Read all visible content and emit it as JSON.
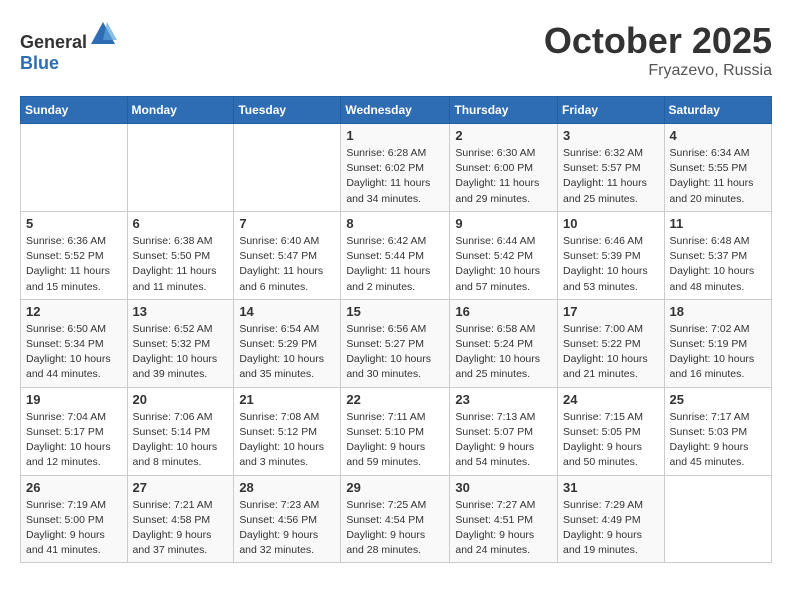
{
  "logo": {
    "text_general": "General",
    "text_blue": "Blue"
  },
  "title": {
    "month_year": "October 2025",
    "location": "Fryazevo, Russia"
  },
  "headers": [
    "Sunday",
    "Monday",
    "Tuesday",
    "Wednesday",
    "Thursday",
    "Friday",
    "Saturday"
  ],
  "weeks": [
    [
      {
        "day": "",
        "sunrise": "",
        "sunset": "",
        "daylight": ""
      },
      {
        "day": "",
        "sunrise": "",
        "sunset": "",
        "daylight": ""
      },
      {
        "day": "",
        "sunrise": "",
        "sunset": "",
        "daylight": ""
      },
      {
        "day": "1",
        "sunrise": "Sunrise: 6:28 AM",
        "sunset": "Sunset: 6:02 PM",
        "daylight": "Daylight: 11 hours and 34 minutes."
      },
      {
        "day": "2",
        "sunrise": "Sunrise: 6:30 AM",
        "sunset": "Sunset: 6:00 PM",
        "daylight": "Daylight: 11 hours and 29 minutes."
      },
      {
        "day": "3",
        "sunrise": "Sunrise: 6:32 AM",
        "sunset": "Sunset: 5:57 PM",
        "daylight": "Daylight: 11 hours and 25 minutes."
      },
      {
        "day": "4",
        "sunrise": "Sunrise: 6:34 AM",
        "sunset": "Sunset: 5:55 PM",
        "daylight": "Daylight: 11 hours and 20 minutes."
      }
    ],
    [
      {
        "day": "5",
        "sunrise": "Sunrise: 6:36 AM",
        "sunset": "Sunset: 5:52 PM",
        "daylight": "Daylight: 11 hours and 15 minutes."
      },
      {
        "day": "6",
        "sunrise": "Sunrise: 6:38 AM",
        "sunset": "Sunset: 5:50 PM",
        "daylight": "Daylight: 11 hours and 11 minutes."
      },
      {
        "day": "7",
        "sunrise": "Sunrise: 6:40 AM",
        "sunset": "Sunset: 5:47 PM",
        "daylight": "Daylight: 11 hours and 6 minutes."
      },
      {
        "day": "8",
        "sunrise": "Sunrise: 6:42 AM",
        "sunset": "Sunset: 5:44 PM",
        "daylight": "Daylight: 11 hours and 2 minutes."
      },
      {
        "day": "9",
        "sunrise": "Sunrise: 6:44 AM",
        "sunset": "Sunset: 5:42 PM",
        "daylight": "Daylight: 10 hours and 57 minutes."
      },
      {
        "day": "10",
        "sunrise": "Sunrise: 6:46 AM",
        "sunset": "Sunset: 5:39 PM",
        "daylight": "Daylight: 10 hours and 53 minutes."
      },
      {
        "day": "11",
        "sunrise": "Sunrise: 6:48 AM",
        "sunset": "Sunset: 5:37 PM",
        "daylight": "Daylight: 10 hours and 48 minutes."
      }
    ],
    [
      {
        "day": "12",
        "sunrise": "Sunrise: 6:50 AM",
        "sunset": "Sunset: 5:34 PM",
        "daylight": "Daylight: 10 hours and 44 minutes."
      },
      {
        "day": "13",
        "sunrise": "Sunrise: 6:52 AM",
        "sunset": "Sunset: 5:32 PM",
        "daylight": "Daylight: 10 hours and 39 minutes."
      },
      {
        "day": "14",
        "sunrise": "Sunrise: 6:54 AM",
        "sunset": "Sunset: 5:29 PM",
        "daylight": "Daylight: 10 hours and 35 minutes."
      },
      {
        "day": "15",
        "sunrise": "Sunrise: 6:56 AM",
        "sunset": "Sunset: 5:27 PM",
        "daylight": "Daylight: 10 hours and 30 minutes."
      },
      {
        "day": "16",
        "sunrise": "Sunrise: 6:58 AM",
        "sunset": "Sunset: 5:24 PM",
        "daylight": "Daylight: 10 hours and 25 minutes."
      },
      {
        "day": "17",
        "sunrise": "Sunrise: 7:00 AM",
        "sunset": "Sunset: 5:22 PM",
        "daylight": "Daylight: 10 hours and 21 minutes."
      },
      {
        "day": "18",
        "sunrise": "Sunrise: 7:02 AM",
        "sunset": "Sunset: 5:19 PM",
        "daylight": "Daylight: 10 hours and 16 minutes."
      }
    ],
    [
      {
        "day": "19",
        "sunrise": "Sunrise: 7:04 AM",
        "sunset": "Sunset: 5:17 PM",
        "daylight": "Daylight: 10 hours and 12 minutes."
      },
      {
        "day": "20",
        "sunrise": "Sunrise: 7:06 AM",
        "sunset": "Sunset: 5:14 PM",
        "daylight": "Daylight: 10 hours and 8 minutes."
      },
      {
        "day": "21",
        "sunrise": "Sunrise: 7:08 AM",
        "sunset": "Sunset: 5:12 PM",
        "daylight": "Daylight: 10 hours and 3 minutes."
      },
      {
        "day": "22",
        "sunrise": "Sunrise: 7:11 AM",
        "sunset": "Sunset: 5:10 PM",
        "daylight": "Daylight: 9 hours and 59 minutes."
      },
      {
        "day": "23",
        "sunrise": "Sunrise: 7:13 AM",
        "sunset": "Sunset: 5:07 PM",
        "daylight": "Daylight: 9 hours and 54 minutes."
      },
      {
        "day": "24",
        "sunrise": "Sunrise: 7:15 AM",
        "sunset": "Sunset: 5:05 PM",
        "daylight": "Daylight: 9 hours and 50 minutes."
      },
      {
        "day": "25",
        "sunrise": "Sunrise: 7:17 AM",
        "sunset": "Sunset: 5:03 PM",
        "daylight": "Daylight: 9 hours and 45 minutes."
      }
    ],
    [
      {
        "day": "26",
        "sunrise": "Sunrise: 7:19 AM",
        "sunset": "Sunset: 5:00 PM",
        "daylight": "Daylight: 9 hours and 41 minutes."
      },
      {
        "day": "27",
        "sunrise": "Sunrise: 7:21 AM",
        "sunset": "Sunset: 4:58 PM",
        "daylight": "Daylight: 9 hours and 37 minutes."
      },
      {
        "day": "28",
        "sunrise": "Sunrise: 7:23 AM",
        "sunset": "Sunset: 4:56 PM",
        "daylight": "Daylight: 9 hours and 32 minutes."
      },
      {
        "day": "29",
        "sunrise": "Sunrise: 7:25 AM",
        "sunset": "Sunset: 4:54 PM",
        "daylight": "Daylight: 9 hours and 28 minutes."
      },
      {
        "day": "30",
        "sunrise": "Sunrise: 7:27 AM",
        "sunset": "Sunset: 4:51 PM",
        "daylight": "Daylight: 9 hours and 24 minutes."
      },
      {
        "day": "31",
        "sunrise": "Sunrise: 7:29 AM",
        "sunset": "Sunset: 4:49 PM",
        "daylight": "Daylight: 9 hours and 19 minutes."
      },
      {
        "day": "",
        "sunrise": "",
        "sunset": "",
        "daylight": ""
      }
    ]
  ]
}
